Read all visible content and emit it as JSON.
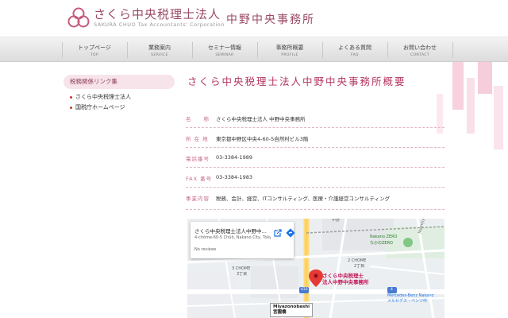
{
  "header": {
    "brand_main": "さくら中央税理士法人",
    "brand_sub": "SAKURA CHUO Tax Accountants' Corporation",
    "office": "中野中央事務所"
  },
  "nav": [
    {
      "jp": "トップページ",
      "en": "TOP"
    },
    {
      "jp": "業務案内",
      "en": "SERVICE"
    },
    {
      "jp": "セミナー情報",
      "en": "SEMINAR"
    },
    {
      "jp": "事務所概要",
      "en": "PROFILE"
    },
    {
      "jp": "よくある質問",
      "en": "FAQ"
    },
    {
      "jp": "お問い合わせ",
      "en": "CONTACT"
    }
  ],
  "sidebar": {
    "title": "税務関係リンク集",
    "links": [
      "さくら中央税理士法人",
      "国税庁ホームページ"
    ]
  },
  "main": {
    "title": "さくら中央税理士法人中野中央事務所概要",
    "rows": [
      {
        "label": "名　　称",
        "value": "さくら中央税理士法人 中野中央事務所"
      },
      {
        "label": "所 在 地",
        "value": "東京都中野区中央4-60-5自然村ビル3階"
      },
      {
        "label": "電話番号",
        "value": "03-3384-1989"
      },
      {
        "label": "FAX 番号",
        "value": "03-3384-1983"
      },
      {
        "label": "事業内容",
        "value": "税務、会計、経営、ITコンサルティング、医療・介護経営コンサルティング"
      }
    ]
  },
  "map": {
    "place_name": "さくら中央税理士法人中野中央事務所",
    "address": "4-chōme-60-5 Chūō, Nakano City, Tokyo",
    "reviews": "No reviews",
    "pin_label_1": "さくら中央税理士",
    "pin_label_2": "法人中野中央事務所",
    "labels": {
      "nakano": "中野",
      "nakano_zero": "Nakano ZERO",
      "nakano_zero_jp": "なかのZERO",
      "momijiyama": "Momijiyama-dori",
      "chome2": "2 CHOME",
      "chome2_jp": "2丁目",
      "chome3": "3 CHOME",
      "chome3_jp": "3丁目",
      "mercedes": "Mercedes-Benz Nakano",
      "mercedes_jp": "メルセデス・ベンツ中",
      "station_en": "Miyazonobashi",
      "station_jp": "宮園橋",
      "road_433": "433",
      "road_4": "4"
    }
  },
  "colors": {
    "accent": "#b5365f",
    "label": "#c66c89",
    "pin": "#e53935"
  }
}
